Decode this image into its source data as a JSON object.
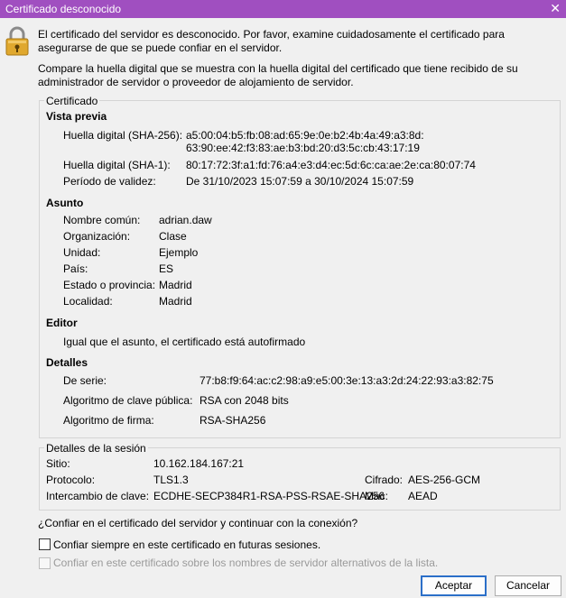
{
  "window": {
    "title": "Certificado desconocido",
    "close_glyph": "✕"
  },
  "intro_text": "El certificado del servidor es desconocido. Por favor, examine cuidadosamente el certificado para asegurarse de que se puede confiar en el servidor.",
  "compare_text": "Compare la huella digital que se muestra con la huella digital del certificado que tiene recibido de su administrador de servidor o proveedor de alojamiento de servidor.",
  "certificate": {
    "legend": "Certificado",
    "preview": {
      "heading": "Vista previa",
      "sha256_label": "Huella digital (SHA-256):",
      "sha256_line1": "a5:00:04:b5:fb:08:ad:65:9e:0e:b2:4b:4a:49:a3:8d:",
      "sha256_line2": "63:90:ee:42:f3:83:ae:b3:bd:20:d3:5c:cb:43:17:19",
      "sha1_label": "Huella digital (SHA-1):",
      "sha1_value": "80:17:72:3f:a1:fd:76:a4:e3:d4:ec:5d:6c:ca:ae:2e:ca:80:07:74",
      "validity_label": "Período de validez:",
      "validity_value": "De 31/10/2023 15:07:59 a 30/10/2024 15:07:59"
    },
    "subject": {
      "heading": "Asunto",
      "rows": [
        {
          "label": "Nombre común:",
          "value": "adrian.daw"
        },
        {
          "label": "Organización:",
          "value": "Clase"
        },
        {
          "label": "Unidad:",
          "value": "Ejemplo"
        },
        {
          "label": "País:",
          "value": "ES"
        },
        {
          "label": "Estado o provincia:",
          "value": "Madrid"
        },
        {
          "label": "Localidad:",
          "value": "Madrid"
        }
      ]
    },
    "issuer": {
      "heading": "Editor",
      "text": "Igual que el asunto, el certificado está autofirmado"
    },
    "details": {
      "heading": "Detalles",
      "serial_label": "De serie:",
      "serial_value": "77:b8:f9:64:ac:c2:98:a9:e5:00:3e:13:a3:2d:24:22:93:a3:82:75",
      "pubkey_label": "Algoritmo de clave pública:",
      "pubkey_value": "RSA con 2048 bits",
      "sig_label": "Algoritmo de firma:",
      "sig_value": "RSA-SHA256"
    }
  },
  "session": {
    "legend": "Detalles de la sesión",
    "site_label": "Sitio:",
    "site_value": "10.162.184.167:21",
    "protocol_label": "Protocolo:",
    "protocol_value": "TLS1.3",
    "cipher_label": "Cifrado:",
    "cipher_value": "AES-256-GCM",
    "kex_label": "Intercambio de clave:",
    "kex_value": "ECDHE-SECP384R1-RSA-PSS-RSAE-SHA256",
    "mac_label": "Mac:",
    "mac_value": "AEAD"
  },
  "question": "¿Confiar en el certificado del servidor y continuar con la conexión?",
  "options": {
    "always_trust": {
      "label": "Confiar siempre en este certificado en futuras sesiones.",
      "checked": false,
      "enabled": true
    },
    "alt_names": {
      "label": "Confiar en este certificado sobre los nombres de servidor alternativos de la lista.",
      "checked": false,
      "enabled": false
    }
  },
  "buttons": {
    "accept": "Aceptar",
    "cancel": "Cancelar"
  },
  "colors": {
    "titlebar": "#a04fc0",
    "window_bg": "#f0f0f0",
    "accent": "#2b6fc8",
    "lock": "#e0a82e"
  },
  "icons": {
    "warning": "padlock-warning-icon",
    "close": "close-icon"
  }
}
